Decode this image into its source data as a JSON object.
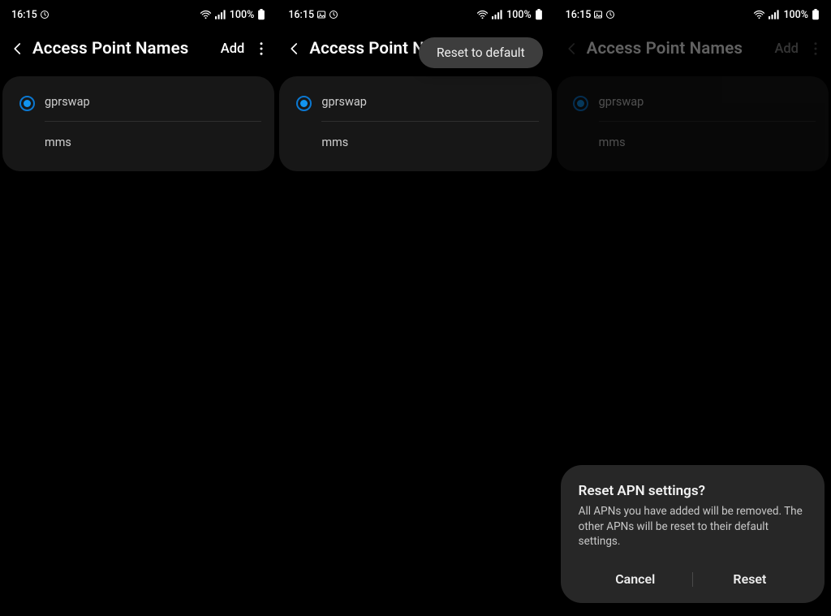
{
  "status": {
    "time": "16:15",
    "battery_text": "100%"
  },
  "pane1": {
    "title": "Access Point Names",
    "add": "Add",
    "apn1": "gprswap",
    "apn2": "mms"
  },
  "pane2": {
    "title": "Access Point Nam",
    "menu_item": "Reset to default",
    "apn1": "gprswap",
    "apn2": "mms"
  },
  "pane3": {
    "title": "Access Point Names",
    "add": "Add",
    "apn1": "gprswap",
    "apn2": "mms",
    "dialog": {
      "title": "Reset APN settings?",
      "body": "All APNs you have added will be removed. The other APNs will be reset to their default settings.",
      "cancel": "Cancel",
      "reset": "Reset"
    }
  }
}
